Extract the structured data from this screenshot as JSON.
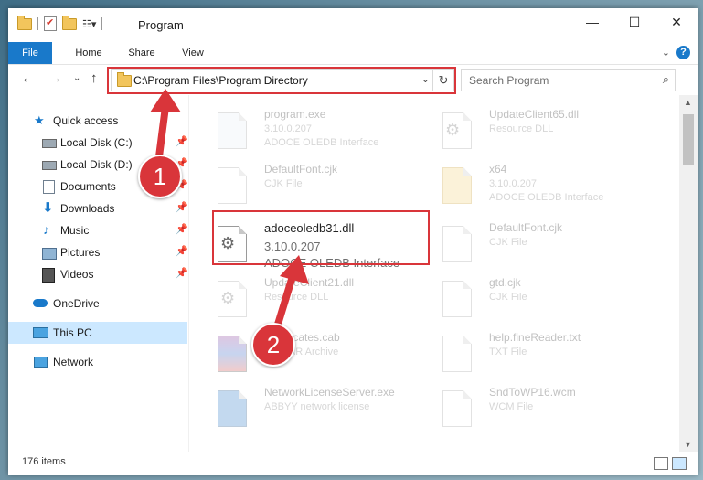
{
  "window": {
    "title": "Program",
    "minimize_icon": "minimize-icon",
    "maximize_icon": "maximize-icon",
    "close_icon": "close-icon"
  },
  "ribbon": {
    "tabs": [
      "File",
      "Home",
      "Share",
      "View"
    ],
    "help": "?"
  },
  "address": {
    "path": "C:\\Program Files\\Program Directory"
  },
  "search": {
    "placeholder": "Search Program"
  },
  "nav": {
    "items": [
      {
        "label": "Quick access",
        "icon": "star-icon",
        "pinned": false
      },
      {
        "label": "Local Disk (C:)",
        "icon": "drive-icon",
        "pinned": true
      },
      {
        "label": "Local Disk (D:)",
        "icon": "drive-icon",
        "pinned": true
      },
      {
        "label": "Documents",
        "icon": "documents-icon",
        "pinned": true
      },
      {
        "label": "Downloads",
        "icon": "downloads-icon",
        "pinned": true
      },
      {
        "label": "Music",
        "icon": "music-icon",
        "pinned": true
      },
      {
        "label": "Pictures",
        "icon": "pictures-icon",
        "pinned": true
      },
      {
        "label": "Videos",
        "icon": "videos-icon",
        "pinned": true
      },
      {
        "label": "OneDrive",
        "icon": "cloud-icon",
        "pinned": false
      },
      {
        "label": "This PC",
        "icon": "computer-icon",
        "pinned": false
      },
      {
        "label": "Network",
        "icon": "network-icon",
        "pinned": false
      }
    ]
  },
  "files": [
    {
      "name": "program.exe",
      "line1": "3.10.0.207",
      "line2": "ADOCE OLEDB Interface"
    },
    {
      "name": "UpdateClient65.dll",
      "line1": "Resource DLL",
      "line2": ""
    },
    {
      "name": "DefaultFont.cjk",
      "line1": "CJK File",
      "line2": ""
    },
    {
      "name": "x64",
      "line1": "3.10.0.207",
      "line2": "ADOCE OLEDB Interface"
    },
    {
      "name": "adoceoledb31.dll",
      "line1": "3.10.0.207",
      "line2": "ADOCE OLEDB Interface"
    },
    {
      "name": "DefaultFont.cjk",
      "line1": "CJK File",
      "line2": ""
    },
    {
      "name": "UpdateClient21.dll",
      "line1": "Resource DLL",
      "line2": ""
    },
    {
      "name": "gtd.cjk",
      "line1": "CJK File",
      "line2": ""
    },
    {
      "name": "Certificates.cab",
      "line1": "WinRAR Archive",
      "line2": ""
    },
    {
      "name": "help.fineReader.txt",
      "line1": "TXT File",
      "line2": ""
    },
    {
      "name": "NetworkLicenseServer.exe",
      "line1": "ABBYY network license",
      "line2": ""
    },
    {
      "name": "SndToWP16.wcm",
      "line1": "WCM File",
      "line2": ""
    }
  ],
  "callouts": {
    "one": "1",
    "two": "2"
  },
  "status": {
    "count": "176 items"
  },
  "colors": {
    "accent": "#1979ca",
    "callout": "#d9353a",
    "selection": "#cce8ff"
  }
}
